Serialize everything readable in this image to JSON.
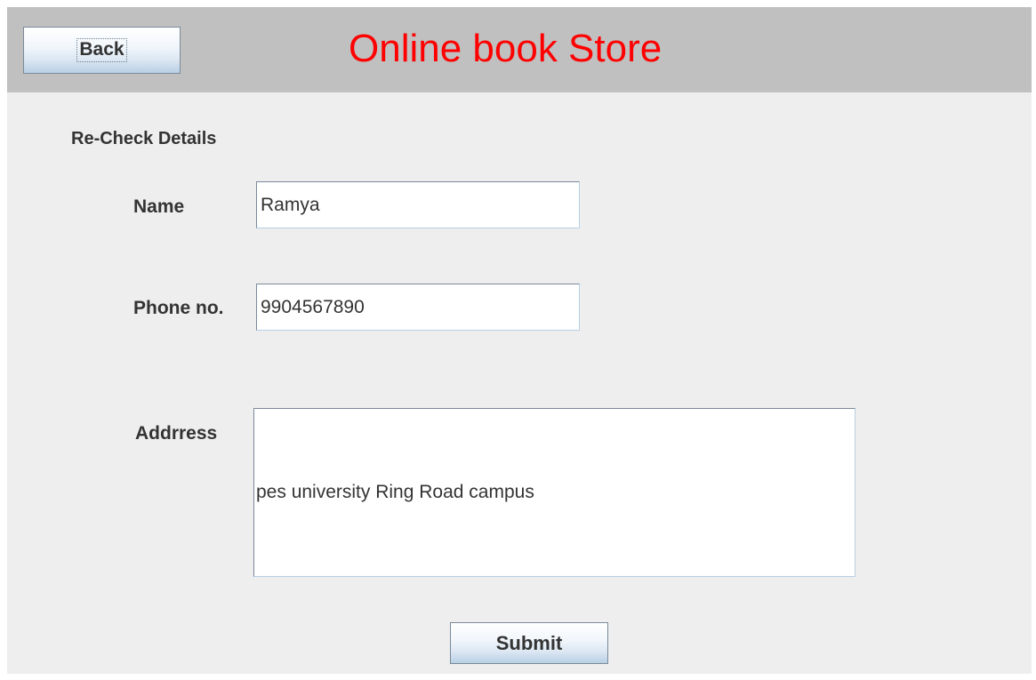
{
  "header": {
    "back_label": "Back",
    "title": "Online book Store"
  },
  "form": {
    "section_title": "Re-Check Details",
    "name_label": "Name",
    "name_value": "Ramya",
    "phone_label": "Phone no.",
    "phone_value": "9904567890",
    "address_label": "Addrress",
    "address_value": "pes university Ring Road campus",
    "submit_label": "Submit"
  },
  "colors": {
    "header_bg": "#c0c0c0",
    "window_bg": "#eeeeee",
    "title_color": "#ff0000"
  }
}
